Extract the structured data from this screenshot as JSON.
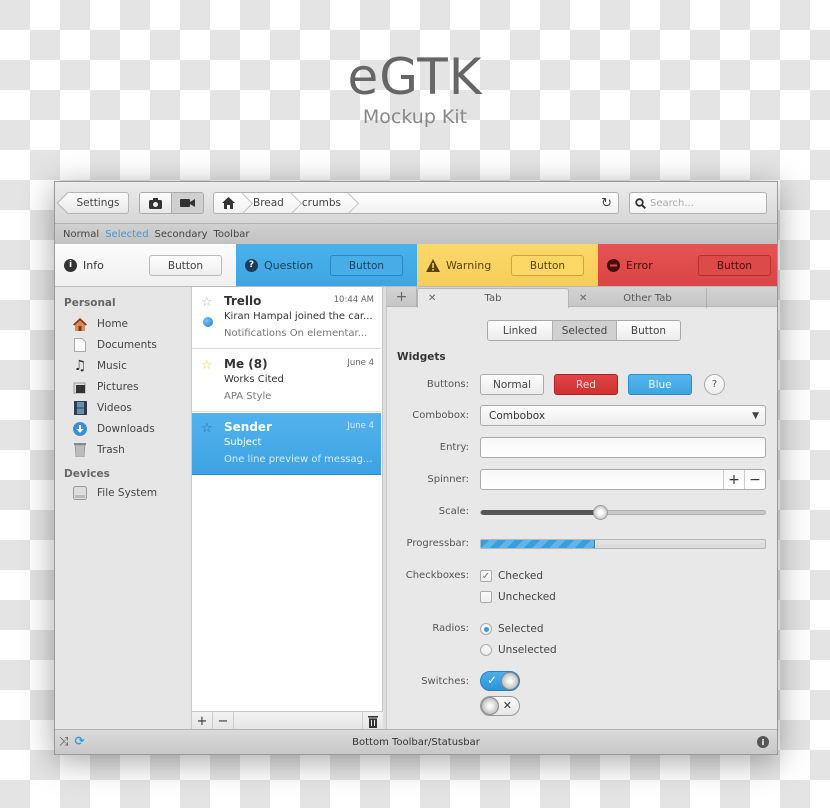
{
  "hero": {
    "title": "eGTK",
    "subtitle": "Mockup Kit"
  },
  "titlebar": {
    "settings_label": "Settings",
    "mode_buttons": [
      {
        "icon": "camera-icon",
        "active": false
      },
      {
        "icon": "video-camera-icon",
        "active": true
      }
    ],
    "breadcrumbs": [
      {
        "icon": "home-icon"
      },
      {
        "label": "Bread"
      },
      {
        "label": "crumbs"
      }
    ],
    "reload_icon": "reload-icon",
    "search_placeholder": "Search..."
  },
  "secondary_toolbar": {
    "items": [
      "Normal",
      "Selected",
      "Secondary",
      "Toolbar"
    ],
    "selected_index": 1
  },
  "infobars": [
    {
      "type": "info",
      "label": "Info",
      "button": "Button",
      "icon": "info-icon",
      "color": "#f5f5f5"
    },
    {
      "type": "question",
      "label": "Question",
      "button": "Button",
      "icon": "question-icon",
      "color": "#43a9e5"
    },
    {
      "type": "warning",
      "label": "Warning",
      "button": "Button",
      "icon": "warning-icon",
      "color": "#f9d260"
    },
    {
      "type": "error",
      "label": "Error",
      "button": "Button",
      "icon": "error-icon",
      "color": "#df4b4b"
    }
  ],
  "sidebar": {
    "sections": [
      {
        "heading": "Personal",
        "items": [
          {
            "label": "Home",
            "icon": "home-icon"
          },
          {
            "label": "Documents",
            "icon": "document-icon"
          },
          {
            "label": "Music",
            "icon": "music-icon"
          },
          {
            "label": "Pictures",
            "icon": "pictures-icon"
          },
          {
            "label": "Videos",
            "icon": "videos-icon"
          },
          {
            "label": "Downloads",
            "icon": "downloads-icon"
          },
          {
            "label": "Trash",
            "icon": "trash-icon"
          }
        ]
      },
      {
        "heading": "Devices",
        "items": [
          {
            "label": "File System",
            "icon": "drive-icon"
          }
        ]
      }
    ]
  },
  "messages": [
    {
      "sender": "Trello",
      "time": "10:44 AM",
      "line2": "Kiran Hampal joined the car...",
      "line3": "Notifications On elementar...",
      "starred": false,
      "unread": true,
      "selected": false
    },
    {
      "sender": "Me (8)",
      "time": "June 4",
      "line2": "Works Cited",
      "line3": "APA Style",
      "starred": true,
      "unread": false,
      "selected": false
    },
    {
      "sender": "Sender",
      "time": "June 4",
      "line2": "Subject",
      "line3": "One line preview of messag...",
      "starred": false,
      "unread": false,
      "selected": true
    }
  ],
  "list_actions": {
    "add": "+",
    "remove": "−"
  },
  "tabs": [
    {
      "label": "Tab",
      "active": true
    },
    {
      "label": "Other Tab",
      "active": false
    }
  ],
  "linked_buttons": [
    {
      "label": "Linked",
      "active": false
    },
    {
      "label": "Selected",
      "active": true
    },
    {
      "label": "Button",
      "active": false
    }
  ],
  "widgets": {
    "heading": "Widgets",
    "buttons_label": "Buttons:",
    "buttons": [
      {
        "label": "Normal",
        "color": "#f5f5f5"
      },
      {
        "label": "Red",
        "color": "#d93838"
      },
      {
        "label": "Blue",
        "color": "#43a9e5"
      }
    ],
    "help_label": "?",
    "combobox_label": "Combobox:",
    "combobox_value": "Combobox",
    "entry_label": "Entry:",
    "entry_value": "",
    "spinner_label": "Spinner:",
    "spinner_value": "",
    "scale_label": "Scale:",
    "scale_value": 0.42,
    "progress_label": "Progressbar:",
    "progress_value": 0.4,
    "checkboxes_label": "Checkboxes:",
    "checkboxes": [
      {
        "label": "Checked",
        "checked": true
      },
      {
        "label": "Unchecked",
        "checked": false
      }
    ],
    "radios_label": "Radios:",
    "radios": [
      {
        "label": "Selected",
        "selected": true
      },
      {
        "label": "Unselected",
        "selected": false
      }
    ],
    "switches_label": "Switches:",
    "switches": [
      {
        "on": true
      },
      {
        "on": false
      }
    ]
  },
  "statusbar": {
    "text": "Bottom Toolbar/Statusbar",
    "left_icons": [
      "shuffle-icon",
      "repeat-icon"
    ],
    "right_icon": "info-icon"
  },
  "colors": {
    "accent": "#3a9bd8",
    "info": "#f5f5f5",
    "question": "#43a9e5",
    "warning": "#f9d260",
    "error": "#df4b4b"
  }
}
